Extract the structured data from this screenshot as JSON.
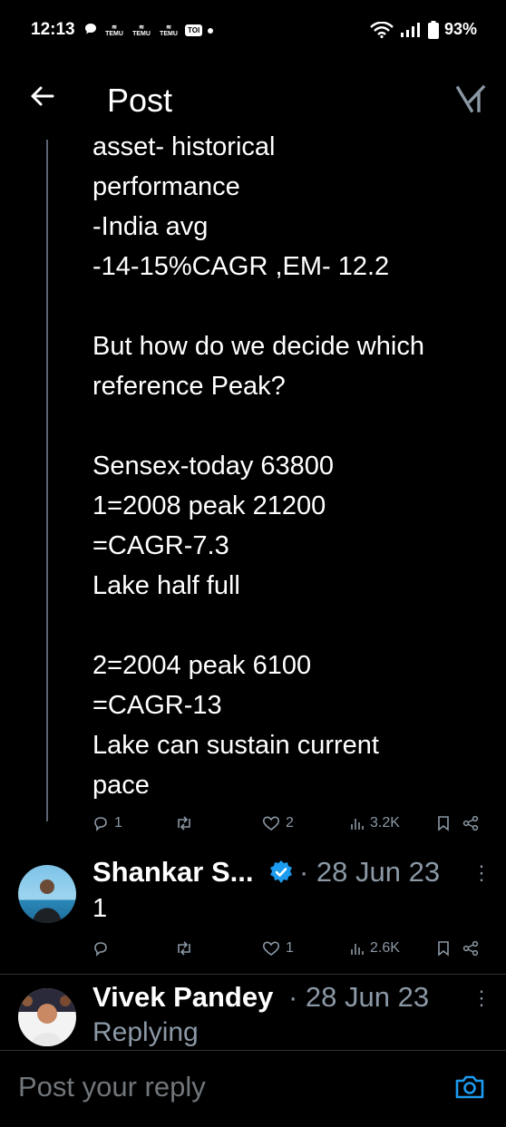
{
  "status": {
    "time": "12:13",
    "notif_apps": [
      "TEMU",
      "TEMU",
      "TEMU"
    ],
    "toi": "TOI",
    "battery": "93%"
  },
  "header": {
    "title": "Post"
  },
  "post": {
    "lines": "asset- historical\nperformance\n-India avg\n-14-15%CAGR ,EM- 12.2\n\nBut how do we decide which\nreference Peak?\n\nSensex-today 63800\n1=2008 peak 21200\n=CAGR-7.3\nLake half full\n\n2=2004 peak 6100\n=CAGR-13\nLake can sustain current\npace",
    "actions": {
      "replies": "1",
      "reposts": "",
      "likes": "2",
      "views": "3.2K"
    }
  },
  "replies": [
    {
      "name": "Shankar S...",
      "verified": true,
      "date": "· 28 Jun 23",
      "text": "1",
      "actions": {
        "replies": "",
        "reposts": "",
        "likes": "1",
        "views": "2.6K"
      }
    },
    {
      "name": "Vivek Pandey",
      "date": "· 28 Jun 23",
      "text": "Replying"
    }
  ],
  "composer": {
    "placeholder": "Post your reply"
  },
  "colors": {
    "background": "#000000",
    "text": "#e7e9ea",
    "muted": "#8b98a5",
    "verified": "#1d9bf0"
  }
}
